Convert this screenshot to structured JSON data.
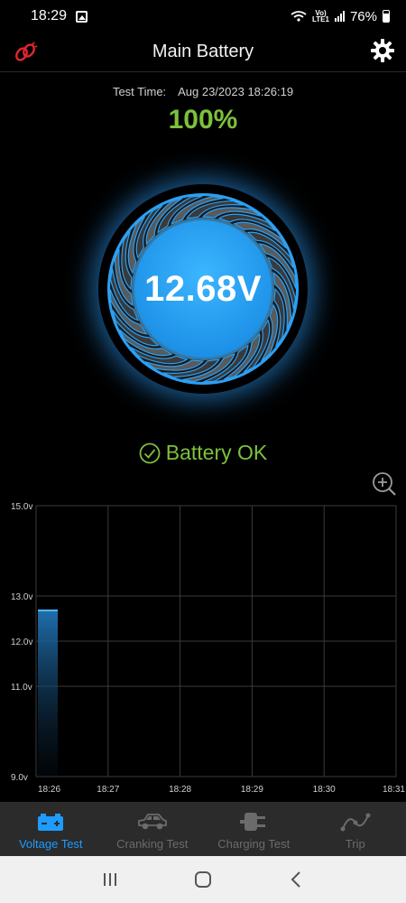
{
  "status_bar": {
    "time": "18:29",
    "lte_top": "Vo)",
    "lte_bottom": "LTE1",
    "battery_pct": "76%"
  },
  "header": {
    "title": "Main Battery"
  },
  "test": {
    "label": "Test Time:",
    "value": "Aug 23/2023 18:26:19"
  },
  "charge_percent": "100%",
  "gauge": {
    "voltage": "12.68V"
  },
  "battery_status": "Battery OK",
  "colors": {
    "accent_blue": "#1e9bff",
    "ok_green": "#7cc13b",
    "background": "#000000"
  },
  "chart_data": {
    "type": "bar",
    "y_ticks": [
      "15.0v",
      "13.0v",
      "12.0v",
      "11.0v",
      "9.0v"
    ],
    "x_ticks": [
      "18:26",
      "18:27",
      "18:28",
      "18:29",
      "18:30",
      "18:31"
    ],
    "bars": [
      {
        "x": "18:26",
        "value": 12.68
      }
    ],
    "ylim": [
      9.0,
      15.0
    ],
    "grid": true
  },
  "nav": {
    "items": [
      {
        "label": "Voltage Test",
        "icon": "battery-icon",
        "active": true
      },
      {
        "label": "Cranking Test",
        "icon": "car-icon",
        "active": false
      },
      {
        "label": "Charging Test",
        "icon": "plug-icon",
        "active": false
      },
      {
        "label": "Trip",
        "icon": "route-icon",
        "active": false
      }
    ]
  }
}
